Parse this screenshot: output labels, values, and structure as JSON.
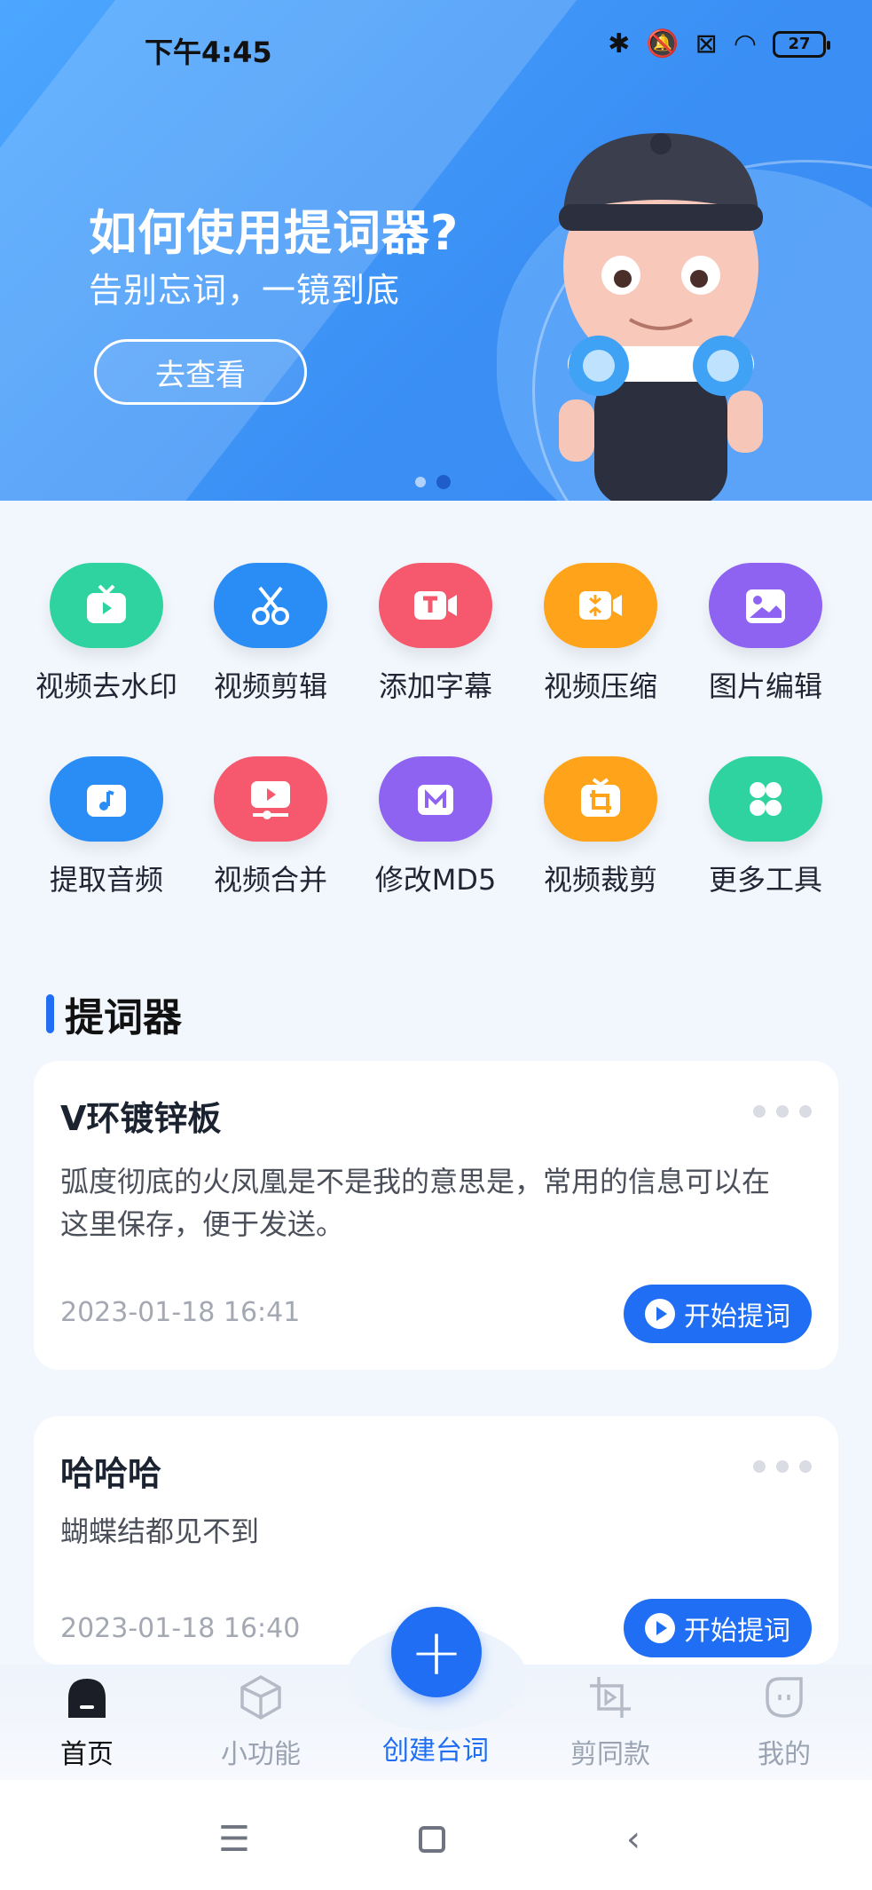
{
  "status_bar": {
    "time": "下午4:45",
    "battery": "27"
  },
  "banner": {
    "title": "如何使用提词器?",
    "subtitle": "告别忘词，一镜到底",
    "button": "去查看"
  },
  "tools": [
    {
      "label": "视频去水印",
      "icon": "video-watermark-icon",
      "color": "#2fd3a0"
    },
    {
      "label": "视频剪辑",
      "icon": "scissors-icon",
      "color": "#2a8df6"
    },
    {
      "label": "添加字幕",
      "icon": "subtitle-icon",
      "color": "#f6586d"
    },
    {
      "label": "视频压缩",
      "icon": "compress-icon",
      "color": "#ffa31a"
    },
    {
      "label": "图片编辑",
      "icon": "image-edit-icon",
      "color": "#8f63f2"
    },
    {
      "label": "提取音频",
      "icon": "audio-extract-icon",
      "color": "#2a8df6"
    },
    {
      "label": "视频合并",
      "icon": "video-merge-icon",
      "color": "#f6586d"
    },
    {
      "label": "修改MD5",
      "icon": "md5-icon",
      "color": "#8f63f2"
    },
    {
      "label": "视频裁剪",
      "icon": "crop-icon",
      "color": "#ffa31a"
    },
    {
      "label": "更多工具",
      "icon": "more-tools-icon",
      "color": "#2fd3a0"
    }
  ],
  "section": {
    "title": "提词器"
  },
  "cards": [
    {
      "title": "V环镀锌板",
      "body": "弧度彻底的火凤凰是不是我的意思是，常用的信息可以在这里保存，便于发送。",
      "date": "2023-01-18 16:41",
      "button": "开始提词"
    },
    {
      "title": "哈哈哈",
      "body": "蝴蝶结都见不到",
      "date": "2023-01-18 16:40",
      "button": "开始提词"
    }
  ],
  "tabbar": {
    "home": "首页",
    "tools": "小功能",
    "create": "创建台词",
    "template": "剪同款",
    "mine": "我的",
    "fab": "+"
  }
}
